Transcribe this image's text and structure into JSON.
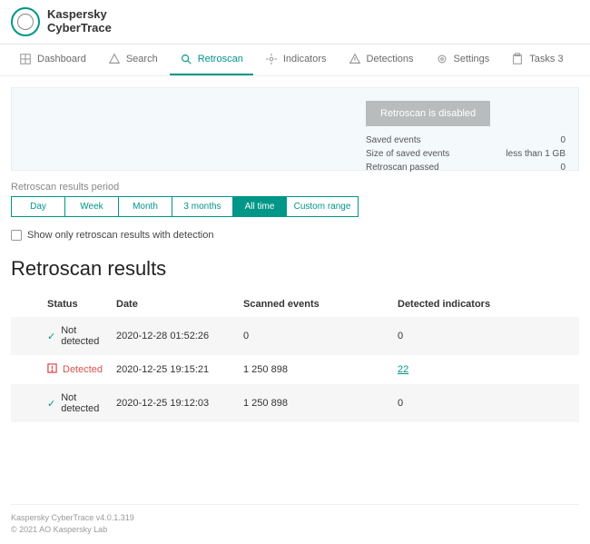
{
  "brand": {
    "line1": "Kaspersky",
    "line2": "CyberTrace"
  },
  "nav": {
    "dashboard": "Dashboard",
    "search": "Search",
    "retroscan": "Retroscan",
    "indicators": "Indicators",
    "detections": "Detections",
    "settings": "Settings",
    "tasks": "Tasks 3"
  },
  "panel": {
    "button": "Retroscan is disabled",
    "stats": {
      "saved_label": "Saved events",
      "saved_value": "0",
      "size_label": "Size of saved events",
      "size_value": "less than 1 GB",
      "passed_label": "Retroscan passed",
      "passed_value": "0"
    }
  },
  "period": {
    "label": "Retroscan results period",
    "day": "Day",
    "week": "Week",
    "month": "Month",
    "three_months": "3 months",
    "all_time": "All time",
    "custom": "Custom range"
  },
  "filter": {
    "show_only": "Show only retroscan results with detection"
  },
  "results": {
    "heading": "Retroscan results",
    "headers": {
      "status": "Status",
      "date": "Date",
      "scanned": "Scanned events",
      "detected": "Detected indicators"
    },
    "rows": [
      {
        "status": "Not detected",
        "date": "2020-12-28 01:52:26",
        "scanned": "0",
        "detected": "0"
      },
      {
        "status": "Detected",
        "date": "2020-12-25 19:15:21",
        "scanned": "1 250 898",
        "detected": "22"
      },
      {
        "status": "Not detected",
        "date": "2020-12-25 19:12:03",
        "scanned": "1 250 898",
        "detected": "0"
      }
    ]
  },
  "footer": {
    "version": "Kaspersky CyberTrace v4.0.1.319",
    "copy": "© 2021 AO Kaspersky Lab"
  }
}
